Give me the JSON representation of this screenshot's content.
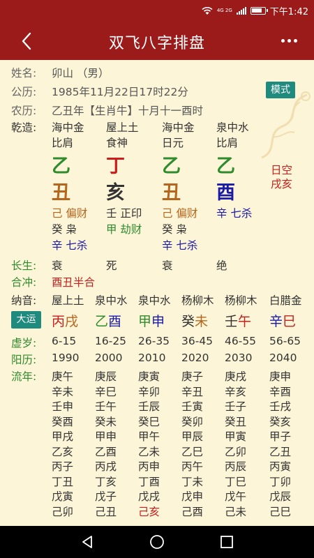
{
  "status": {
    "network": "4G 2G",
    "time": "下午1:42"
  },
  "appbar": {
    "title": "双飞八字排盘"
  },
  "info": {
    "name_label": "姓名:",
    "name_value": "卯山 （男）",
    "gongli_label": "公历:",
    "gongli_value": "1985年11月22日17时22分",
    "nongli_label": "农历:",
    "nongli_value": "乙丑年【生肖牛】十月十一酉时",
    "mode_button": "模式"
  },
  "qianzao": {
    "label": "乾造:",
    "nayin": [
      "海中金",
      "屋上土",
      "海中金",
      "泉中水"
    ],
    "shishen": [
      "比肩",
      "食神",
      "日元",
      "比肩"
    ],
    "gan": [
      "乙",
      "丁",
      "乙",
      "乙"
    ],
    "zhi": [
      "丑",
      "亥",
      "丑",
      "酉"
    ],
    "rikong_line1": "日空",
    "rikong_line2": "戌亥",
    "canggan": [
      [
        "己 偏财",
        "癸 枭",
        "辛 七杀"
      ],
      [
        "壬 正印",
        "甲 劫财"
      ],
      [
        "己 偏财",
        "癸 枭",
        "辛 七杀"
      ],
      [
        "辛 七杀"
      ]
    ]
  },
  "changsheng": {
    "label": "长生:",
    "values": [
      "衰",
      "死",
      "衰",
      "绝"
    ]
  },
  "hechong": {
    "label": "合冲:",
    "value": "酉丑半合"
  },
  "nayin_row": {
    "label": "纳音:",
    "values": [
      "屋上土",
      "泉中水",
      "泉中水",
      "杨柳木",
      "杨柳木",
      "白腊金"
    ]
  },
  "dayun": {
    "button": "大运",
    "gan": [
      "丙",
      "乙",
      "甲",
      "癸",
      "壬",
      "辛"
    ],
    "zhi": [
      "戌",
      "酉",
      "申",
      "未",
      "午",
      "巳"
    ]
  },
  "xusui": {
    "label": "虚岁:",
    "values": [
      "6-15",
      "16-25",
      "26-35",
      "36-45",
      "46-55",
      "56-65"
    ]
  },
  "yangli": {
    "label": "阳历:",
    "values": [
      "1990",
      "2000",
      "2010",
      "2020",
      "2030",
      "2040"
    ]
  },
  "liunian": {
    "label": "流年:",
    "columns": [
      [
        "庚午",
        "辛未",
        "壬申",
        "癸酉",
        "甲戌",
        "乙亥",
        "丙子",
        "丁丑",
        "戊寅",
        "己卯"
      ],
      [
        "庚辰",
        "辛巳",
        "壬午",
        "癸未",
        "甲申",
        "乙酉",
        "丙戌",
        "丁亥",
        "戊子",
        "己丑"
      ],
      [
        "庚寅",
        "辛卯",
        "壬辰",
        "癸巳",
        "甲午",
        "乙未",
        "丙申",
        "丁酉",
        "戊戌",
        "己亥"
      ],
      [
        "庚子",
        "辛丑",
        "壬寅",
        "癸卯",
        "甲辰",
        "乙巳",
        "丙午",
        "丁未",
        "戊申",
        "己酉"
      ],
      [
        "庚戌",
        "辛亥",
        "壬子",
        "癸丑",
        "甲寅",
        "乙卯",
        "丙辰",
        "丁巳",
        "戊午",
        "己未"
      ],
      [
        "庚申",
        "辛酉",
        "壬戌",
        "癸亥",
        "甲子",
        "乙丑",
        "丙寅",
        "丁卯",
        "戊辰",
        "己巳"
      ]
    ]
  },
  "colors": {
    "header": "#9b1b1b",
    "background": "#fdf5d7",
    "wood": "#2e8b2e",
    "fire": "#c81e1e",
    "earth": "#b5651d",
    "water": "#1a1aa8",
    "metal": "#333333",
    "teal": "#1f8a7e"
  }
}
